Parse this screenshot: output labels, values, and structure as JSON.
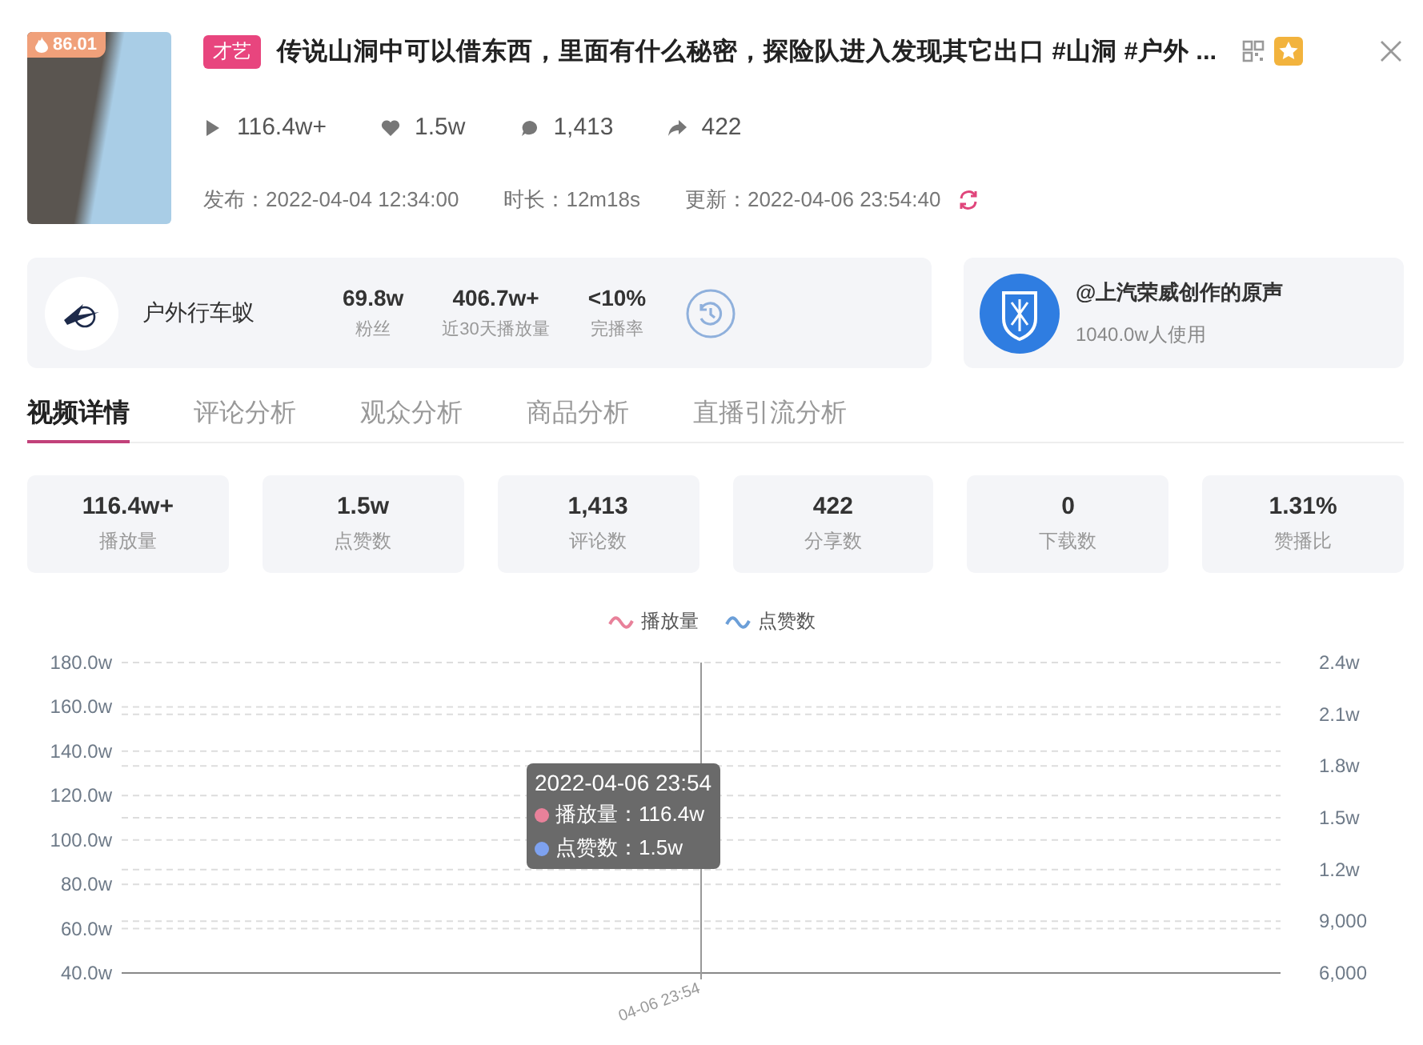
{
  "video": {
    "score": "86.01",
    "tag": "才艺",
    "title": "传说山洞中可以借东西，里面有什么秘密，探险队进入发现其它出口 #山洞 #户外 ...",
    "stats": [
      {
        "kind": "play",
        "value": "116.4w+"
      },
      {
        "kind": "like",
        "value": "1.5w"
      },
      {
        "kind": "comment",
        "value": "1,413"
      },
      {
        "kind": "share",
        "value": "422"
      }
    ],
    "meta": [
      "发布：2022-04-04 12:34:00",
      "时长：12m18s",
      "更新：2022-04-06 23:54:40"
    ]
  },
  "author": {
    "name": "户外行车蚁",
    "metrics": [
      {
        "value": "69.8w",
        "label": "粉丝"
      },
      {
        "value": "406.7w+",
        "label": "近30天播放量"
      },
      {
        "value": "<10%",
        "label": "完播率"
      }
    ]
  },
  "music": {
    "title": "@上汽荣威创作的原声",
    "usage": "1040.0w人使用"
  },
  "tabs": [
    {
      "label": "视频详情",
      "selected": true
    },
    {
      "label": "评论分析",
      "selected": false
    },
    {
      "label": "观众分析",
      "selected": false
    },
    {
      "label": "商品分析",
      "selected": false
    },
    {
      "label": "直播引流分析",
      "selected": false
    }
  ],
  "summary": [
    {
      "value": "116.4w+",
      "label": "播放量"
    },
    {
      "value": "1.5w",
      "label": "点赞数"
    },
    {
      "value": "1,413",
      "label": "评论数"
    },
    {
      "value": "422",
      "label": "分享数"
    },
    {
      "value": "0",
      "label": "下载数"
    },
    {
      "value": "1.31%",
      "label": "赞播比"
    }
  ],
  "chart": {
    "legend": [
      {
        "name": "播放量",
        "color": "#e8819a"
      },
      {
        "name": "点赞数",
        "color": "#6c9fd8"
      }
    ],
    "left_axis_labels": [
      "180.0w",
      "160.0w",
      "140.0w",
      "120.0w",
      "100.0w",
      "80.0w",
      "60.0w",
      "40.0w"
    ],
    "right_axis_labels": [
      "2.4w",
      "2.1w",
      "1.8w",
      "1.5w",
      "1.2w",
      "9,000",
      "6,000"
    ],
    "x_axis_labels": [
      "04-06 23:54"
    ],
    "tooltip": {
      "title": "2022-04-06 23:54",
      "rows": [
        {
          "text": "播放量：116.4w",
          "color": "#e8819a"
        },
        {
          "text": "点赞数：1.5w",
          "color": "#7ea2f0"
        }
      ]
    }
  }
}
